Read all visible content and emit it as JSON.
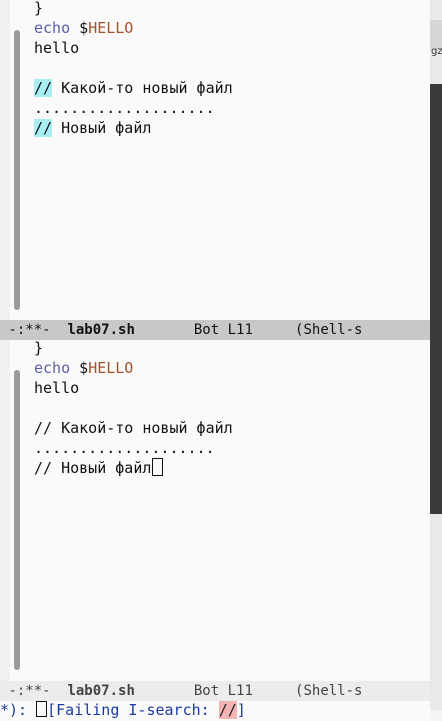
{
  "top_pane": {
    "lines": {
      "l1": "}",
      "l2_kw": "echo",
      "l2_sp": " $",
      "l2_var": "HELLO",
      "l3": "hello",
      "l5_comment": "//",
      "l5_text": " Какой-то новый файл",
      "l6": "....................",
      "l7_comment": "//",
      "l7_text": " Новый файл"
    },
    "modeline": {
      "prefix": " -:**-  ",
      "buffer_name": "lab07.sh",
      "position": "       Bot L11     ",
      "mode": "(Shell-s"
    }
  },
  "bottom_pane": {
    "lines": {
      "l1": "}",
      "l2_kw": "echo",
      "l2_sp": " $",
      "l2_var": "HELLO",
      "l3": "hello",
      "l5": "// Какой-то новый файл",
      "l6": "....................",
      "l7": "// Новый файл"
    },
    "modeline": {
      "prefix": " -:**-  ",
      "buffer_name": "lab07.sh",
      "position": "       Bot L11     ",
      "mode": "(Shell-s"
    }
  },
  "minibuffer": {
    "prefix": "*): ",
    "label": "[Failing I-search: ",
    "query": "//",
    "suffix": "]"
  },
  "side_strip": {
    "text": "gz"
  },
  "colors": {
    "keyword": "#5c5ca8",
    "variable": "#a0522d",
    "isearch_highlight": "#a8eef2",
    "failing_search": "#f4b4b4",
    "minibuffer_prompt": "#1a3aa0"
  }
}
